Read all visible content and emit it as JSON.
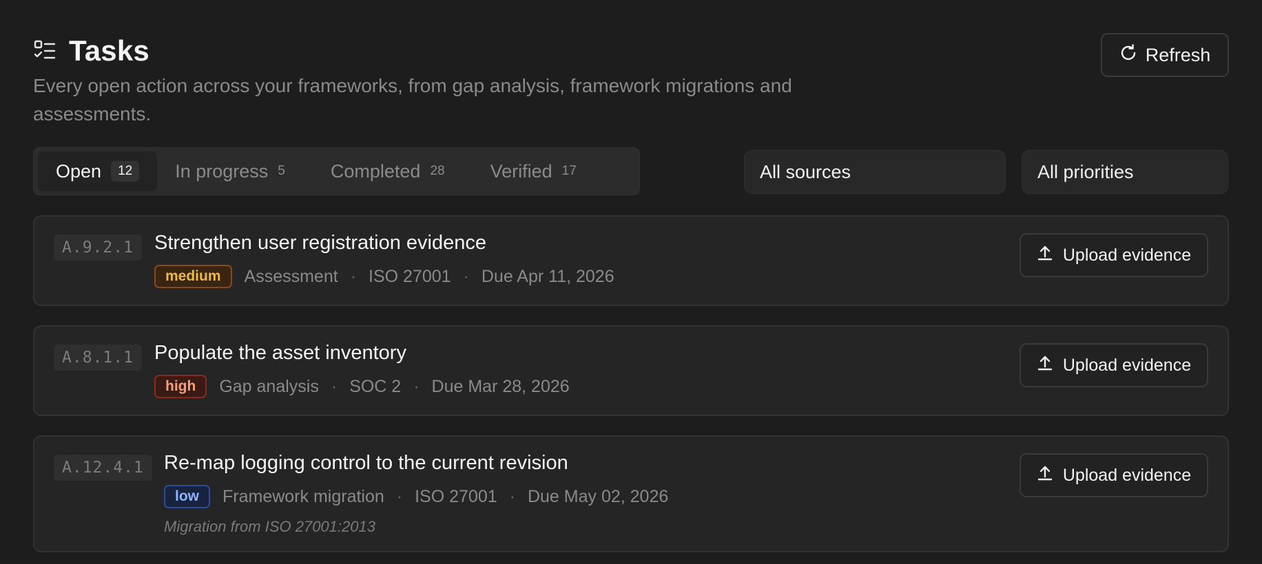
{
  "header": {
    "title": "Tasks",
    "subtitle": "Every open action across your frameworks, from gap analysis, framework migrations and assessments.",
    "refresh_label": "Refresh"
  },
  "tabs": [
    {
      "label": "Open",
      "count": "12",
      "active": true
    },
    {
      "label": "In progress",
      "count": "5",
      "active": false
    },
    {
      "label": "Completed",
      "count": "28",
      "active": false
    },
    {
      "label": "Verified",
      "count": "17",
      "active": false
    }
  ],
  "filters": {
    "sources": "All sources",
    "priorities": "All priorities"
  },
  "tasks": [
    {
      "code": "A.9.2.1",
      "title": "Strengthen user registration evidence",
      "priority": "medium",
      "source": "Assessment",
      "framework": "ISO 27001",
      "due": "Due Apr 11, 2026",
      "note": "",
      "action": "Upload evidence"
    },
    {
      "code": "A.8.1.1",
      "title": "Populate the asset inventory",
      "priority": "high",
      "source": "Gap analysis",
      "framework": "SOC 2",
      "due": "Due Mar 28, 2026",
      "note": "",
      "action": "Upload evidence"
    },
    {
      "code": "A.12.4.1",
      "title": "Re-map logging control to the current revision",
      "priority": "low",
      "source": "Framework migration",
      "framework": "ISO 27001",
      "due": "Due May 02, 2026",
      "note": "Migration from ISO 27001:2013",
      "action": "Upload evidence"
    }
  ],
  "icons": {
    "title": "checklist-icon",
    "refresh": "refresh-icon",
    "upload": "upload-icon"
  },
  "colors": {
    "background": "#1d1d1d",
    "card": "#252525",
    "medium": "#e9b949",
    "high": "#f1a07a",
    "low": "#8fb4ff"
  }
}
